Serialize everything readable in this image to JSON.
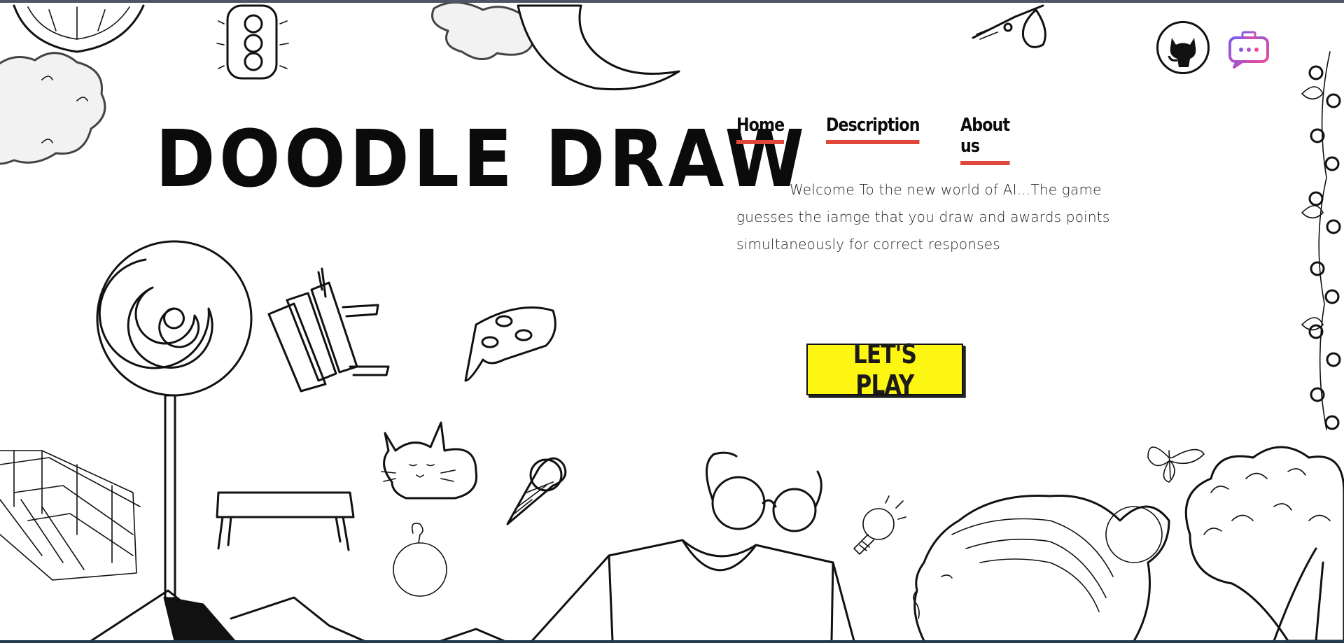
{
  "app": {
    "title": "DOODLE DRAW"
  },
  "nav": {
    "items": [
      {
        "label": "Home"
      },
      {
        "label": "Description"
      },
      {
        "label": "About us"
      }
    ],
    "underline_color": "#e0493a"
  },
  "description": {
    "text": "Welcome To the new world of AI...The game guesses the iamge that you draw and awards points simultaneously for correct responses"
  },
  "cta": {
    "label": "LET'S PLAY",
    "color": "#fdf512"
  },
  "header_icons": [
    {
      "name": "github-icon"
    },
    {
      "name": "chat-bot-icon"
    }
  ],
  "doodle_icons": [
    "lemon-icon",
    "cactus-icon",
    "cloud-icon",
    "moon-icon",
    "guitar-icon",
    "lollipop-icon",
    "chair-icon",
    "pizza-icon",
    "bridge-icon",
    "table-icon",
    "cat-icon",
    "ice-cream-icon",
    "apple-icon",
    "glasses-icon",
    "tshirt-icon",
    "lightbulb-icon",
    "girl-portrait-icon",
    "butterfly-icon",
    "tree-icon",
    "vine-icon",
    "mountain-icon"
  ]
}
